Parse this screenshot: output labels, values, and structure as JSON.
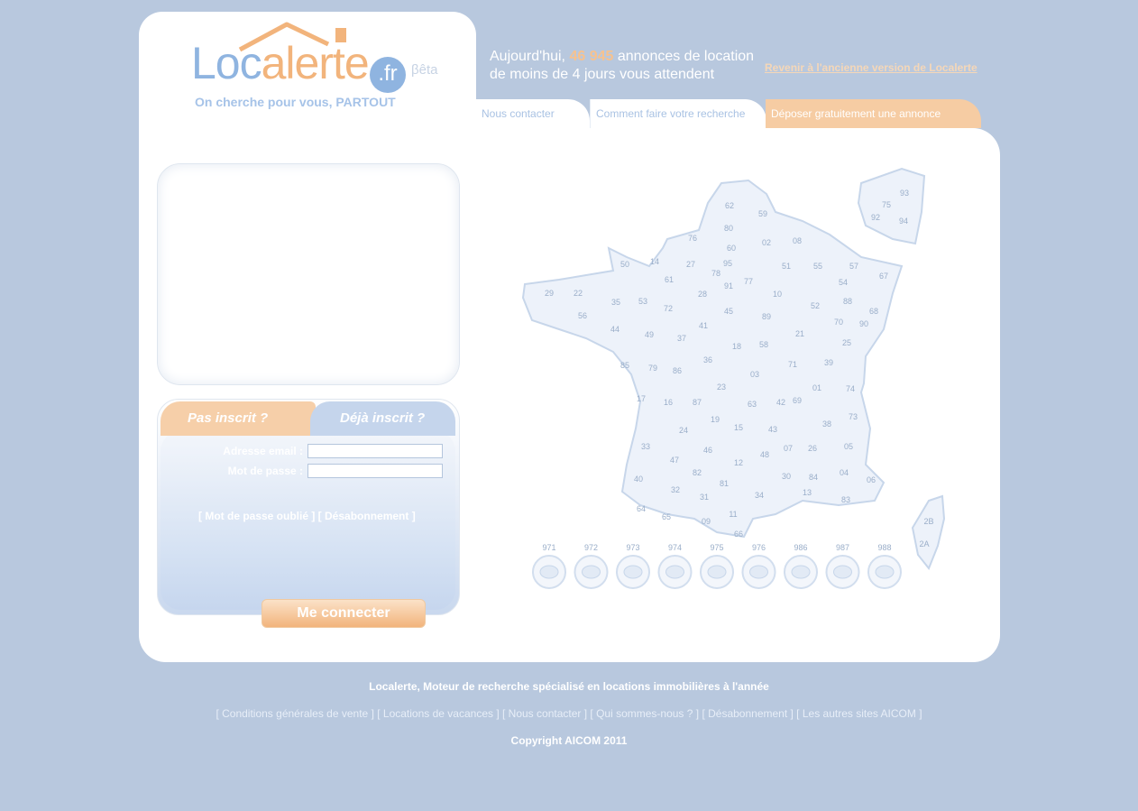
{
  "header": {
    "logo_main": "Loc",
    "logo_accent": "alerte",
    "logo_domain": ".fr",
    "logo_beta": "βêta",
    "tagline": "On cherche pour vous, PARTOUT",
    "headline_pre": "Aujourd'hui,",
    "headline_count": "46 945",
    "headline_post": "annonces de location de moins de 4 jours vous attendent",
    "old_version_link": "Revenir à l'ancienne version de Localerte"
  },
  "tabs": [
    {
      "label": "Nous contacter"
    },
    {
      "label": "Comment faire votre recherche"
    },
    {
      "label": "Déposer gratuitement une annonce"
    }
  ],
  "login": {
    "tab_not_registered": "Pas inscrit ?",
    "tab_registered": "Déjà inscrit ?",
    "email_label": "Adresse email :",
    "password_label": "Mot de passe :",
    "email_value": "",
    "password_value": "",
    "links": "[ Mot de passe oublié ] [ Désabonnement ]",
    "connect_button": "Me connecter"
  },
  "map": {
    "departments": [
      "62",
      "59",
      "80",
      "76",
      "02",
      "08",
      "60",
      "14",
      "50",
      "27",
      "95",
      "61",
      "78",
      "91",
      "77",
      "51",
      "55",
      "57",
      "67",
      "54",
      "29",
      "22",
      "35",
      "53",
      "72",
      "28",
      "10",
      "56",
      "44",
      "49",
      "37",
      "45",
      "89",
      "52",
      "88",
      "68",
      "70",
      "90",
      "41",
      "18",
      "21",
      "25",
      "85",
      "79",
      "86",
      "36",
      "58",
      "71",
      "39",
      "03",
      "01",
      "74",
      "17",
      "16",
      "87",
      "23",
      "63",
      "42",
      "69",
      "73",
      "38",
      "24",
      "19",
      "15",
      "43",
      "33",
      "47",
      "46",
      "12",
      "48",
      "07",
      "26",
      "05",
      "04",
      "40",
      "82",
      "30",
      "84",
      "06",
      "83",
      "13",
      "32",
      "81",
      "34",
      "31",
      "64",
      "65",
      "09",
      "11",
      "66",
      "2B",
      "2A"
    ],
    "idf_inset": [
      "93",
      "75",
      "92",
      "94"
    ],
    "overseas": [
      "971",
      "972",
      "973",
      "974",
      "975",
      "976",
      "986",
      "987",
      "988"
    ]
  },
  "footer": {
    "title": "Localerte, Moteur de recherche spécialisé en locations immobilières à l'année",
    "links": [
      "Conditions générales de vente",
      "Locations de vacances",
      "Nous contacter",
      "Qui sommes-nous ?",
      "Désabonnement",
      "Les autres sites AICOM"
    ],
    "copyright": "Copyright AICOM 2011"
  }
}
